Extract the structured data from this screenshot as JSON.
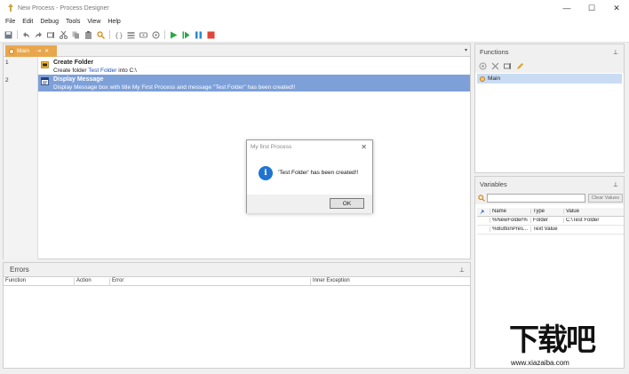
{
  "window": {
    "title": "New Process - Process Designer",
    "controls": [
      "—",
      "☐",
      "✕"
    ]
  },
  "menu": [
    "File",
    "Edit",
    "Debug",
    "Tools",
    "View",
    "Help"
  ],
  "toolbar": {
    "icons": [
      "save-icon",
      "undo-icon",
      "redo-icon",
      "rename-icon",
      "cut-icon",
      "copy-icon",
      "paste-icon",
      "find-icon",
      "braces-icon",
      "comment-icon",
      "uncomment-icon",
      "settings-icon",
      "run-icon",
      "step-icon",
      "pause-icon",
      "stop-icon"
    ]
  },
  "editor": {
    "tab": {
      "label": "Main",
      "pin": "⇥",
      "close": "✕"
    },
    "dropdown": "▾",
    "lines": [
      "1",
      "2"
    ],
    "actions": [
      {
        "name": "Create Folder",
        "desc_prefix": "Create folder ",
        "desc_highlight": "Test Folder",
        "desc_suffix": " into C:\\"
      },
      {
        "name": "Display Message",
        "desc": "Display Message box with title My First Process and message \"Test Folder\" has been created!!"
      }
    ]
  },
  "dialog": {
    "title": "My first Process",
    "close": "✕",
    "icon": "i",
    "message": "'Test Folder' has been created!!",
    "ok": "OK"
  },
  "errors": {
    "title": "Errors",
    "pin": "⊥",
    "columns": [
      "Function",
      "Action",
      "Error",
      "Inner Exception"
    ]
  },
  "functions": {
    "title": "Functions",
    "pin": "⊥",
    "items": [
      "Main"
    ]
  },
  "variables": {
    "title": "Variables",
    "pin": "⊥",
    "search_placeholder": "",
    "clear_label": "Clear Values",
    "columns": [
      "",
      "Name",
      "Type",
      "Value"
    ],
    "rows": [
      {
        "name": "%NewFolder%",
        "type": "Folder",
        "value": "C:\\Test Folder"
      },
      {
        "name": "%ButtonPres...",
        "type": "Text Value",
        "value": ""
      }
    ]
  },
  "watermark": {
    "main": "下载吧",
    "url": "www.xiazaiba.com"
  }
}
